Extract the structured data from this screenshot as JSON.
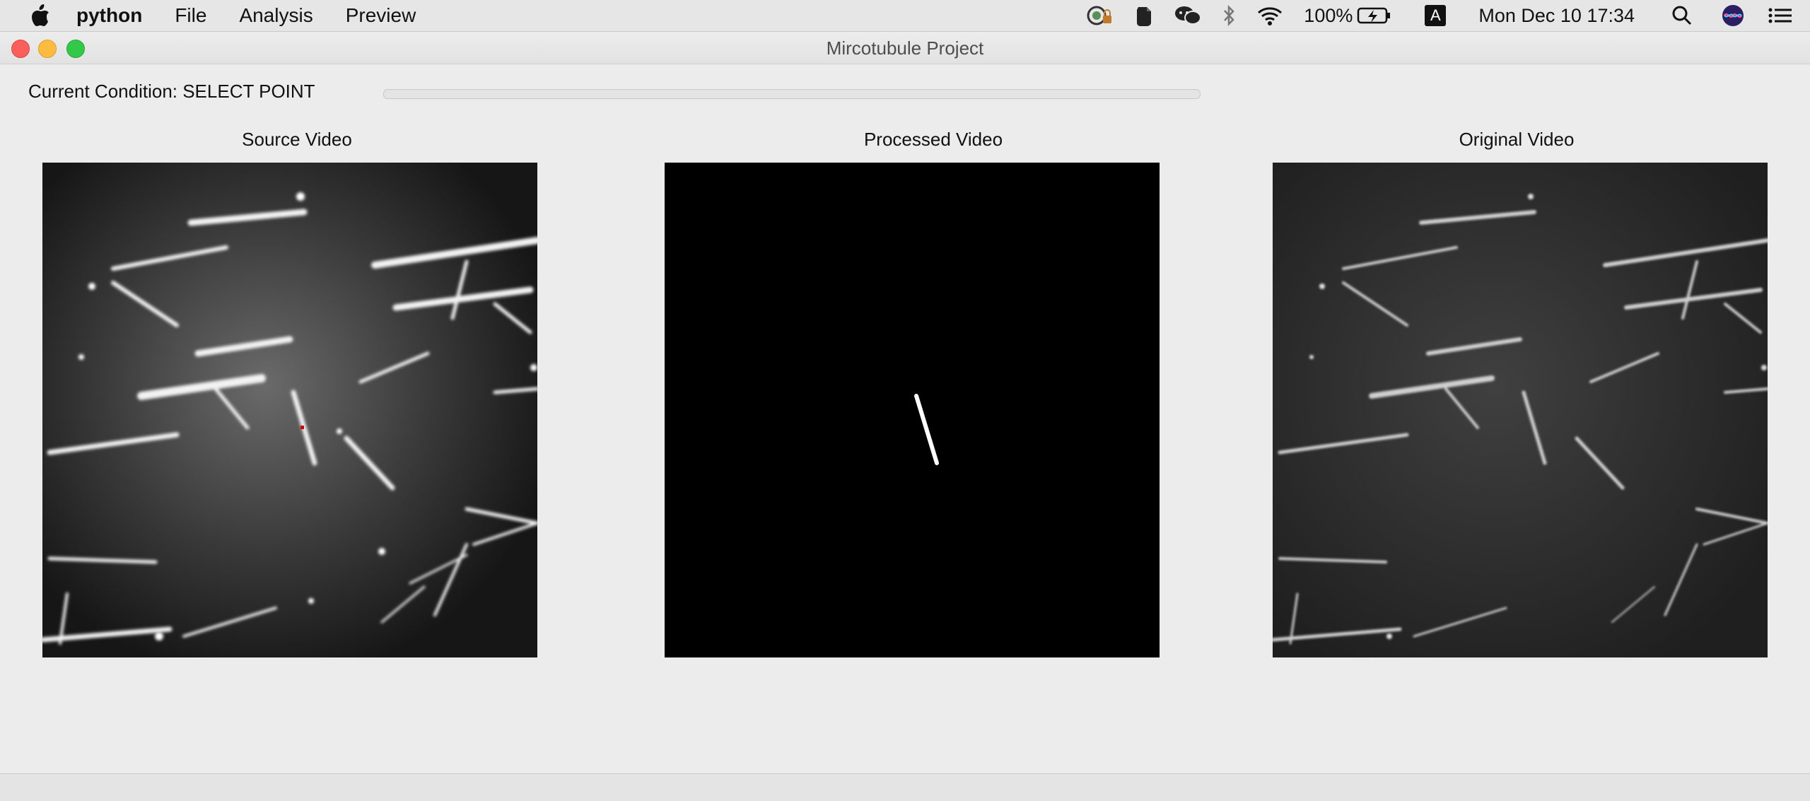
{
  "menubar": {
    "app_name": "python",
    "items": [
      "File",
      "Analysis",
      "Preview"
    ],
    "battery": "100%",
    "input_source": "A",
    "clock": "Mon Dec 10  17:34"
  },
  "window": {
    "title": "Mircotubule Project"
  },
  "condition": {
    "text": "Current Condition: SELECT POINT"
  },
  "progress": {
    "value": 0
  },
  "panels": {
    "source": {
      "title": "Source Video"
    },
    "processed": {
      "title": "Processed Video"
    },
    "original": {
      "title": "Original Video"
    }
  },
  "colors": {
    "selected_point": "#cc0000",
    "accent": "#3d7be0"
  }
}
